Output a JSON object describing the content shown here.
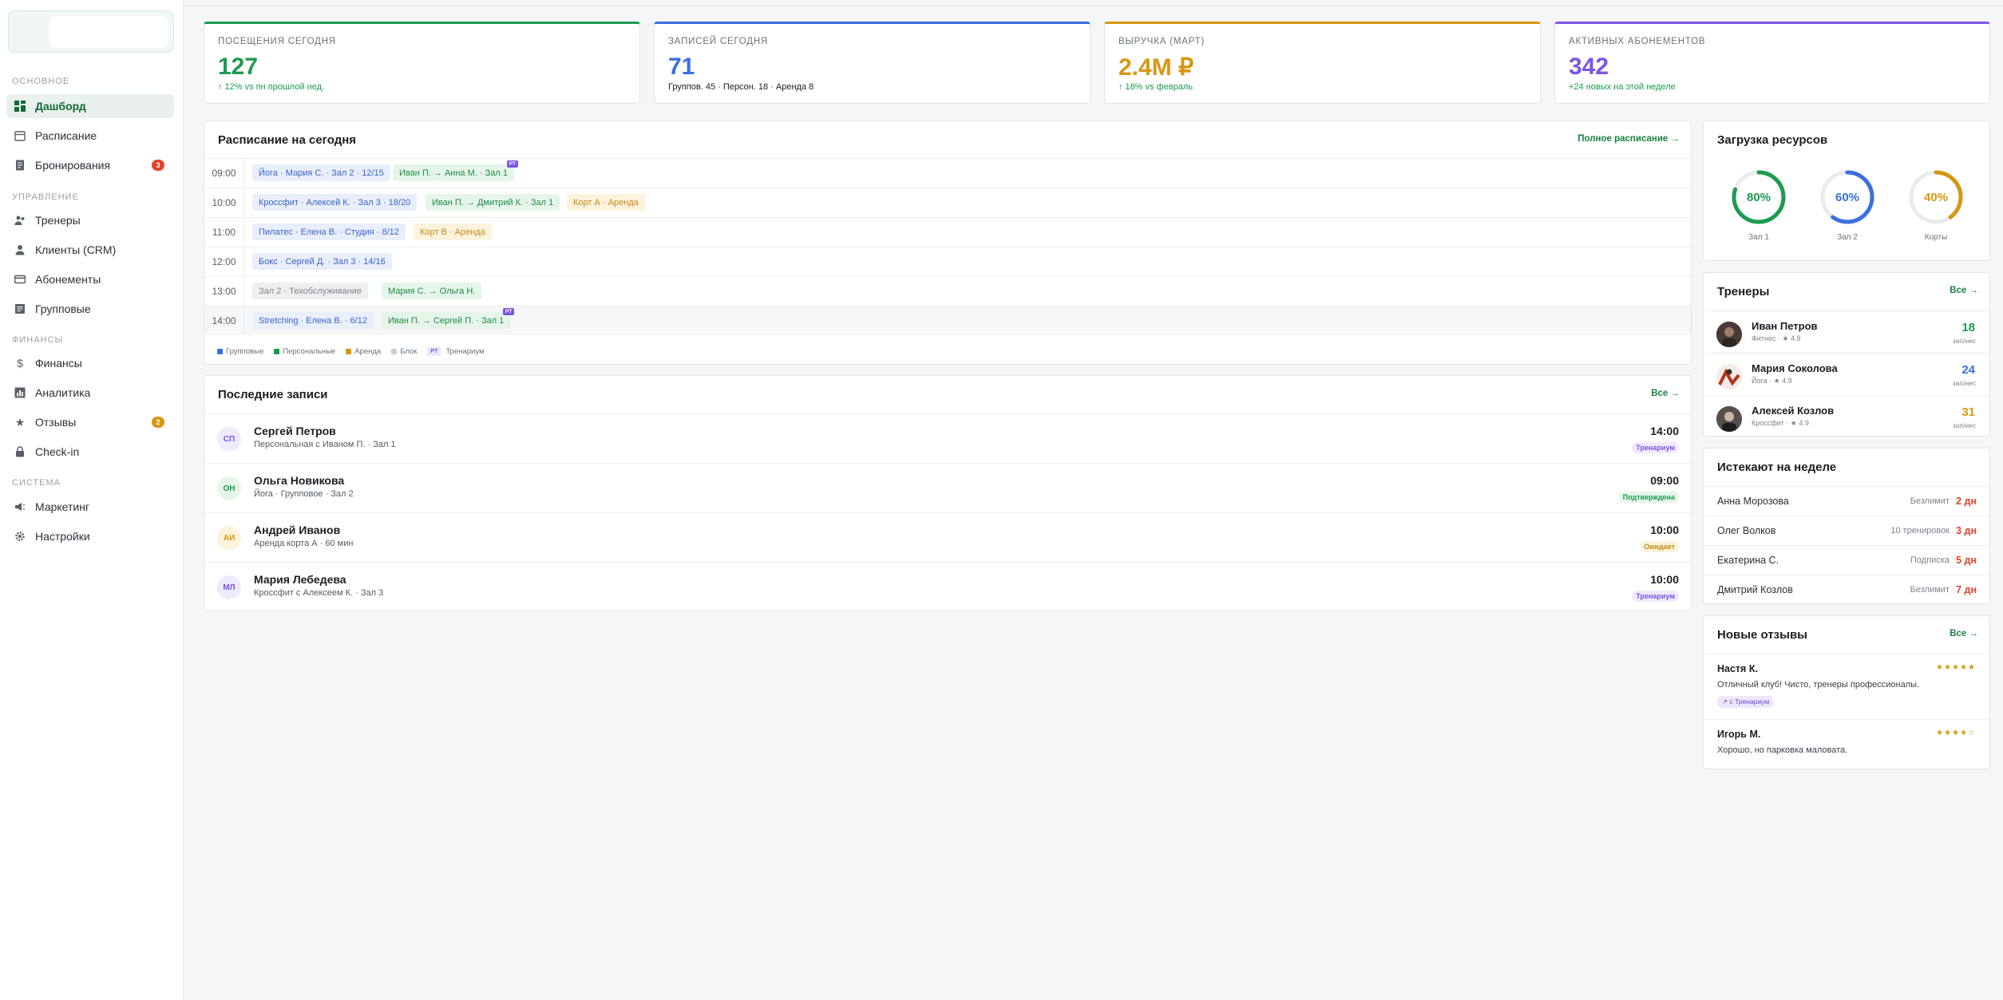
{
  "sidebar": {
    "sections": [
      "ОСНОВНОЕ",
      "УПРАВЛЕНИЕ",
      "ФИНАНСЫ",
      "СИСТЕМА"
    ],
    "items": [
      {
        "label": "Дашборд",
        "icon": "grid-icon",
        "active": true
      },
      {
        "label": "Расписание",
        "icon": "calendar-icon"
      },
      {
        "label": "Бронирования",
        "icon": "document-icon",
        "badge": "3"
      },
      {
        "label": "Тренеры",
        "icon": "users-icon"
      },
      {
        "label": "Клиенты (CRM)",
        "icon": "user-icon"
      },
      {
        "label": "Абонементы",
        "icon": "card-icon"
      },
      {
        "label": "Групповые",
        "icon": "list-icon"
      },
      {
        "label": "Финансы",
        "icon": "dollar-icon"
      },
      {
        "label": "Аналитика",
        "icon": "chart-icon"
      },
      {
        "label": "Отзывы",
        "icon": "star-icon",
        "badge": "2"
      },
      {
        "label": "Check-in",
        "icon": "lock-icon"
      },
      {
        "label": "Маркетинг",
        "icon": "megaphone-icon"
      },
      {
        "label": "Настройки",
        "icon": "gear-icon"
      }
    ],
    "badge_colors": {
      "red": "#e0442a",
      "amber": "#d59713"
    }
  },
  "stats": [
    {
      "label": "ПОСЕЩЕНИЯ СЕГОДНЯ",
      "value": "127",
      "sub": "↑ 12% vs пн прошлой нед.",
      "color": "#1d9b4f"
    },
    {
      "label": "ЗАПИСЕЙ СЕГОДНЯ",
      "value": "71",
      "sub": "Группов. 45 · Персон. 18 · Аренда 8",
      "color": "#3b6fe0"
    },
    {
      "label": "ВЫРУЧКА (МАРТ)",
      "value": "2.4M ₽",
      "sub": "↑ 18% vs февраль",
      "color": "#d59713"
    },
    {
      "label": "АКТИВНЫХ АБОНЕМЕНТОВ",
      "value": "342",
      "sub": "+24 новых на этой неделе",
      "color": "#7a55e3"
    }
  ],
  "schedule": {
    "title": "Расписание на сегодня",
    "link": "Полное расписание →",
    "rows": [
      {
        "time": "09:00",
        "chips": [
          {
            "text": "Йога · Мария С. · Зал 2 · 12/15",
            "type": "g"
          },
          {
            "text": "Иван П. → Анна М. · Зал 1",
            "type": "p",
            "pt": "PT"
          }
        ]
      },
      {
        "time": "10:00",
        "chips": [
          {
            "text": "Кроссфит · Алексей К. · Зал 3 · 18/20",
            "type": "g"
          },
          {
            "text": "Иван П. → Дмитрий К. · Зал 1",
            "type": "p"
          },
          {
            "text": "Корт А · Аренда",
            "type": "a"
          }
        ]
      },
      {
        "time": "11:00",
        "chips": [
          {
            "text": "Пилатес · Елена В. · Студия · 8/12",
            "type": "g"
          },
          {
            "text": "Корт В · Аренда",
            "type": "a"
          }
        ]
      },
      {
        "time": "12:00",
        "chips": [
          {
            "text": "Бокс · Сергей Д. · Зал 3 · 14/16",
            "type": "g"
          }
        ]
      },
      {
        "time": "13:00",
        "chips": [
          {
            "text": "Зал 2 · Техобслуживание",
            "type": "b"
          },
          {
            "text": "Мария С. → Ольга Н.",
            "type": "p"
          }
        ]
      },
      {
        "time": "14:00",
        "chips": [
          {
            "text": "Stretching · Елена В. · 6/12",
            "type": "g"
          },
          {
            "text": "Иван П. → Сергей П. · Зал 1",
            "type": "p",
            "pt": "PT"
          }
        ]
      }
    ],
    "legend": {
      "group": "Групповые",
      "personal": "Персональные",
      "rent": "Аренда",
      "block": "Блок",
      "pt_badge": "PT",
      "pt_label": "Тренариум"
    }
  },
  "bookings": {
    "title": "Последние записи",
    "link": "Все →",
    "items": [
      {
        "initials": "СП",
        "name": "Сергей Петров",
        "desc": "Персональная с Иваном П. · Зал 1",
        "time": "14:00",
        "status": "Тренариум",
        "tone": "violet"
      },
      {
        "initials": "ОН",
        "name": "Ольга Новикова",
        "desc": "Йога · Групповое · Зал 2",
        "time": "09:00",
        "status": "Подтверждена",
        "tone": "green"
      },
      {
        "initials": "АИ",
        "name": "Андрей Иванов",
        "desc": "Аренда корта А · 60 мин",
        "time": "10:00",
        "status": "Ожидает",
        "tone": "amber"
      },
      {
        "initials": "МЛ",
        "name": "Мария Лебедева",
        "desc": "Кроссфит с Алексеем К. · Зал 3",
        "time": "10:00",
        "status": "Тренариум",
        "tone": "violet"
      }
    ]
  },
  "resources": {
    "title": "Загрузка ресурсов",
    "items": [
      {
        "label": "Зал 1",
        "value": "80%",
        "fraction": 0.8,
        "color": "#1d9b4f"
      },
      {
        "label": "Зал 2",
        "value": "60%",
        "fraction": 0.6,
        "color": "#3b6fe0"
      },
      {
        "label": "Корты",
        "value": "40%",
        "fraction": 0.4,
        "color": "#d59713"
      }
    ]
  },
  "trainers": {
    "title": "Тренеры",
    "link": "Все →",
    "items": [
      {
        "name": "Иван Петров",
        "sub": "Фитнес · ★ 4.9",
        "count": "18",
        "unit": "зап/нес",
        "color": "#1d9b4f"
      },
      {
        "name": "Мария Соколова",
        "sub": "Йога · ★ 4.9",
        "count": "24",
        "unit": "зап/нес",
        "color": "#3b6fe0"
      },
      {
        "name": "Алексей Козлов",
        "sub": "Кроссфит · ★ 4.9",
        "count": "31",
        "unit": "зап/нес",
        "color": "#d59713"
      }
    ]
  },
  "expiring": {
    "title": "Истекают на неделе",
    "items": [
      {
        "name": "Анна Морозова",
        "type": "Безлимит",
        "days": "2 дн"
      },
      {
        "name": "Олег Волков",
        "type": "10 тренировок",
        "days": "3 дн"
      },
      {
        "name": "Екатерина С.",
        "type": "Подписка",
        "days": "5 дн"
      },
      {
        "name": "Дмитрий Козлов",
        "type": "Безлимит",
        "days": "7 дн"
      }
    ]
  },
  "reviews": {
    "title": "Новые отзывы",
    "link": "Все →",
    "items": [
      {
        "name": "Настя К.",
        "stars": "★★★★★",
        "text": "Отличный клуб! Чисто, тренеры профессионалы.",
        "tag": "↗ с Тренариум"
      },
      {
        "name": "Игорь М.",
        "stars": "★★★★☆",
        "text": "Хорошо, но парковка маловата."
      }
    ]
  }
}
